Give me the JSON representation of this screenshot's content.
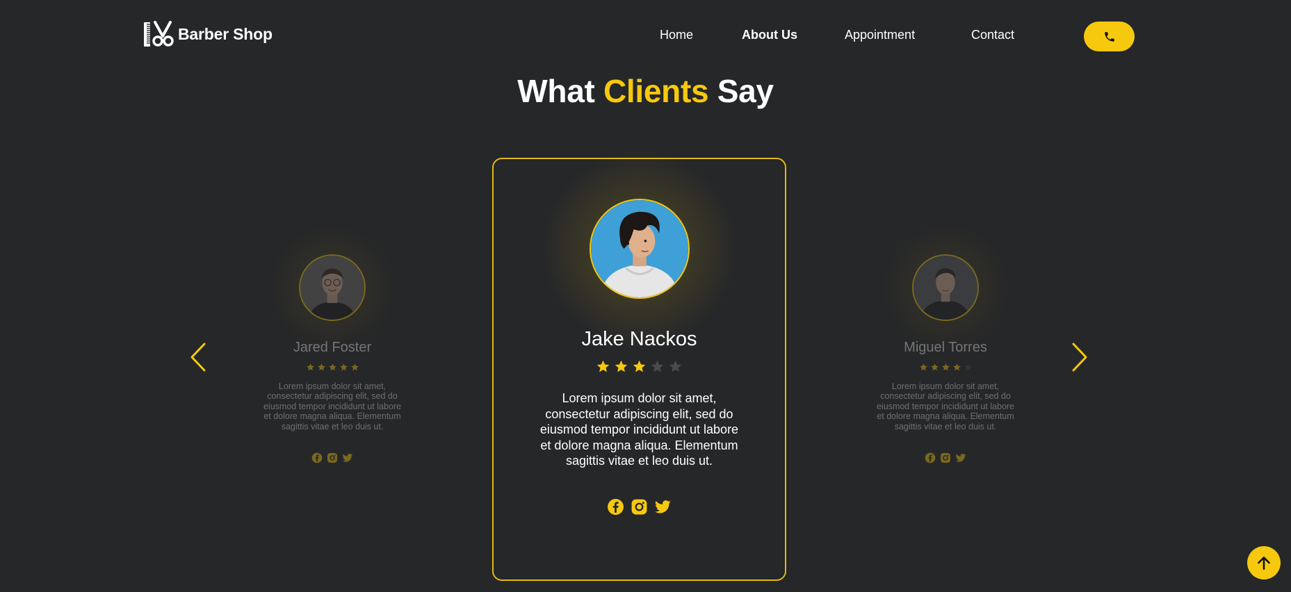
{
  "header": {
    "brand": "Barber Shop",
    "logo_icon": "comb-scissors-icon",
    "nav": [
      {
        "label": "Home",
        "active": false
      },
      {
        "label": "About Us",
        "active": true
      },
      {
        "label": "Appointment",
        "active": false
      },
      {
        "label": "Contact",
        "active": false
      }
    ],
    "call_icon": "phone-icon"
  },
  "section": {
    "title_pre": "What ",
    "title_accent": "Clients",
    "title_post": " Say"
  },
  "testimonials": [
    {
      "name": "Jared Foster",
      "rating": 5,
      "text": "Lorem ipsum dolor sit amet, consectetur adipiscing elit, sed do eiusmod tempor incididunt ut labore et dolore magna aliqua. Elementum sagittis vitae et leo duis ut.",
      "avatar_bg": "#6c6c6c",
      "socials": [
        "facebook-icon",
        "instagram-icon",
        "twitter-icon"
      ]
    },
    {
      "name": "Jake Nackos",
      "rating": 3,
      "text": "Lorem ipsum dolor sit amet, consectetur adipiscing elit, sed do eiusmod tempor incididunt ut labore et dolore magna aliqua. Elementum sagittis vitae et leo duis ut.",
      "avatar_bg": "#3ea0d6",
      "socials": [
        "facebook-icon",
        "instagram-icon",
        "twitter-icon"
      ]
    },
    {
      "name": "Miguel Torres",
      "rating": 4,
      "text": "Lorem ipsum dolor sit amet, consectetur adipiscing elit, sed do eiusmod tempor incididunt ut labore et dolore magna aliqua. Elementum sagittis vitae et leo duis ut.",
      "avatar_bg": "#5a5d60",
      "socials": [
        "facebook-icon",
        "instagram-icon",
        "twitter-icon"
      ]
    }
  ],
  "carousel": {
    "prev_icon": "chevron-left-icon",
    "next_icon": "chevron-right-icon"
  },
  "back_to_top_icon": "arrow-up-icon",
  "colors": {
    "background": "#262729",
    "accent": "#f6c90e",
    "star_empty": "#4a4b4d",
    "text": "#ffffff"
  }
}
